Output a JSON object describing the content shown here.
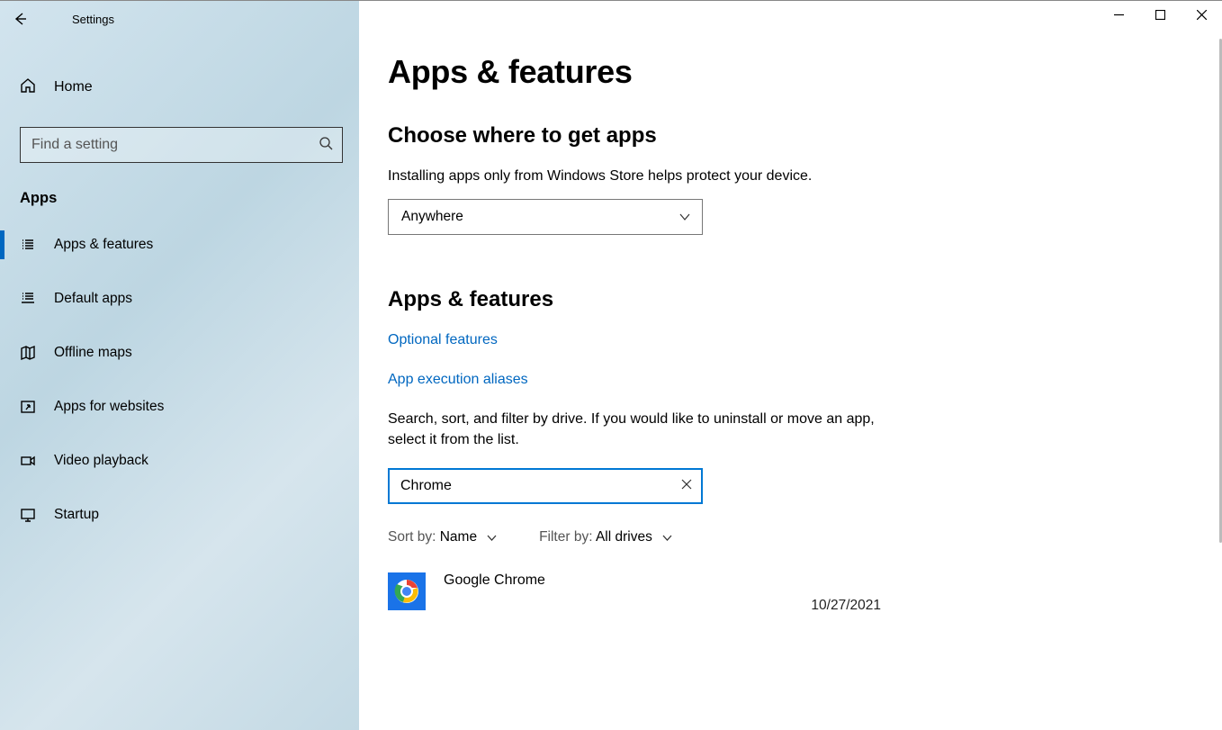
{
  "window": {
    "title": "Settings"
  },
  "sidebar": {
    "home_label": "Home",
    "search_placeholder": "Find a setting",
    "section": "Apps",
    "items": [
      {
        "label": "Apps & features"
      },
      {
        "label": "Default apps"
      },
      {
        "label": "Offline maps"
      },
      {
        "label": "Apps for websites"
      },
      {
        "label": "Video playback"
      },
      {
        "label": "Startup"
      }
    ]
  },
  "main": {
    "title": "Apps & features",
    "choose_header": "Choose where to get apps",
    "choose_desc": "Installing apps only from Windows Store helps protect your device.",
    "choose_value": "Anywhere",
    "af_header": "Apps & features",
    "link_optional": "Optional features",
    "link_alias": "App execution aliases",
    "search_desc": "Search, sort, and filter by drive. If you would like to uninstall or move an app, select it from the list.",
    "search_value": "Chrome",
    "sort_prefix": "Sort by: ",
    "sort_value": "Name",
    "filter_prefix": "Filter by: ",
    "filter_value": "All drives",
    "apps": [
      {
        "name": "Google Chrome",
        "date": "10/27/2021"
      }
    ]
  }
}
